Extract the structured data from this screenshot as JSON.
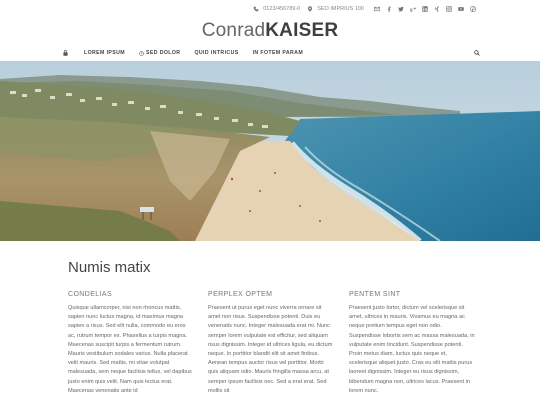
{
  "topbar": {
    "phone": "0123/456789-0",
    "address": "SEO IMPRIUS 100",
    "social_icons": [
      "mail-icon",
      "facebook-icon",
      "twitter-icon",
      "google-plus-icon",
      "linkedin-icon",
      "xing-icon",
      "instagram-icon",
      "youtube-icon",
      "pinterest-icon"
    ]
  },
  "brand": {
    "first": "Conrad",
    "last": "KAISER"
  },
  "nav": {
    "items": [
      {
        "label": "LOREM IPSUM"
      },
      {
        "label": "SED DOLOR"
      },
      {
        "label": "QUID INTRICUS"
      },
      {
        "label": "IN FOTEM PARAM"
      }
    ]
  },
  "main": {
    "title": "Numis matix",
    "columns": [
      {
        "heading": "CONDELIAS",
        "text": "Quisque ullamcorper, nisi non rhoncus mattis, sapien nunc luctus magna, id maximus magna sapien a risus. Sed elit nulla, commodo eu eros ac, rutrum tempor ex. Phasellus a turpis magna. Maecenas suscipit turpis a fermentum rutrum. Mauris vestibulum sodales varius. Nulla placerat velit mauris. Sed mattis, mi vitae volutpat malesuada, sem neque facilisis tellus, vel dapibus justo enim quis velit. Nam quis lectus erat. Maecenas venenatis ante id"
      },
      {
        "heading": "PERPLEX OPTEM",
        "text": "Praesent ut purus eget nunc viverra ornare sit amet non risus. Suspendisse potenti. Duis eu venenatis nunc. Integer malesuada erat mi. Nunc semper lorem vulputate est efficitur, sed aliquam risus dignissim. Integer id ultrices ligula, eu dictum neque. In porttitor blandit elit sit amet finibus. Aenean tempus auctor risus vel porttitor. Morbi quis aliquam odio. Mauris fringilla massa arcu, at semper ipsum facilisis nec. Sed a erat erat. Sed mollis sit"
      },
      {
        "heading": "PENTEM SINT",
        "text": "Praesent justo tortor, dictum vel scelerisque sit amet, ultrices in mauris. Vivamus eu magna ac neque pretium tempus eget non odio. Suspendisse lobortis sem ac massa malesuada, in vulputate enim tincidunt. Suspendisse potenti. Proin metus diam, luctus quis neque et, scelerisque aliquet justo. Cras eu elit mattis purus laoreet dignissim. Integer eu risus dignissim, bibendum magna non, ultrices lacus. Praesent in lorem nunc."
      }
    ]
  }
}
